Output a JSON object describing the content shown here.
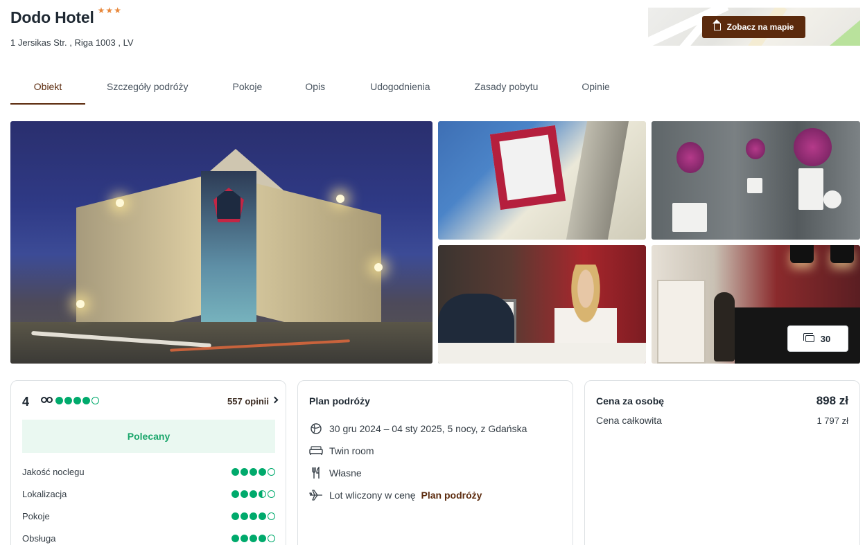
{
  "header": {
    "title": "Dodo Hotel",
    "stars": [
      "★",
      "★",
      "★"
    ],
    "address": "1 Jersikas Str. , Riga 1003 , LV",
    "map_button": "Zobacz na mapie",
    "map_icon": "home-icon"
  },
  "tabs": [
    {
      "label": "Obiekt",
      "active": true
    },
    {
      "label": "Szczegóły podróży"
    },
    {
      "label": "Pokoje"
    },
    {
      "label": "Opis"
    },
    {
      "label": "Udogodnienia"
    },
    {
      "label": "Zasady pobytu"
    },
    {
      "label": "Opinie"
    }
  ],
  "gallery": {
    "count": "30",
    "count_icon": "images-icon"
  },
  "reviews": {
    "score": "4",
    "provider_icon": "tripadvisor-icon",
    "overall_dots": 4,
    "count_label": "557 opinii",
    "badge": "Polecany",
    "categories": [
      {
        "label": "Jakość noclegu",
        "rating": 4
      },
      {
        "label": "Lokalizacja",
        "rating": 3.5
      },
      {
        "label": "Pokoje",
        "rating": 4
      },
      {
        "label": "Obsługa",
        "rating": 4
      }
    ]
  },
  "plan": {
    "title": "Plan podróży",
    "items": [
      {
        "icon": "globe-plane-icon",
        "text": "30 gru 2024 – 04 sty 2025, 5 nocy, z Gdańska"
      },
      {
        "icon": "bed-icon",
        "text": "Twin room"
      },
      {
        "icon": "cutlery-icon",
        "text": "Własne"
      },
      {
        "icon": "plane-icon",
        "text": "Lot wliczony w cenę",
        "link": "Plan podróży"
      }
    ]
  },
  "price": {
    "per_person_label": "Cena za osobę",
    "per_person": "898 zł",
    "total_label": "Cena całkowita",
    "total": "1 797 zł"
  },
  "colors": {
    "brand": "#5b2a0d",
    "star": "#e8873a",
    "rating": "#00aa6c",
    "badge_bg": "#eaf8f1"
  }
}
